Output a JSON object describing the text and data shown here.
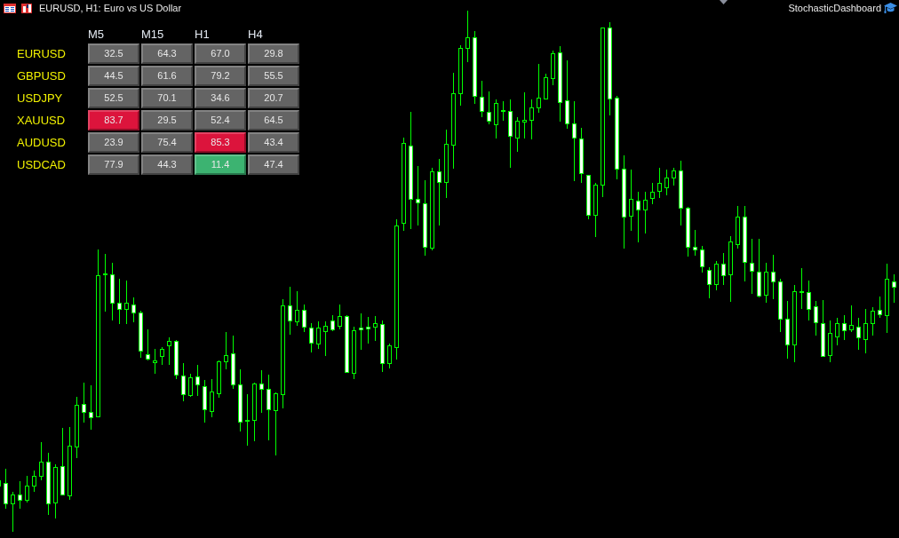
{
  "window": {
    "title": "EURUSD, H1: Euro vs US Dollar"
  },
  "indicator_label": "StochasticDashboard",
  "dashboard": {
    "columns": [
      "M5",
      "M15",
      "H1",
      "H4"
    ],
    "rows": [
      {
        "symbol": "EURUSD",
        "cells": [
          {
            "value": "32.5",
            "color": "#646464"
          },
          {
            "value": "64.3",
            "color": "#646464"
          },
          {
            "value": "67.0",
            "color": "#646464"
          },
          {
            "value": "29.8",
            "color": "#646464"
          }
        ]
      },
      {
        "symbol": "GBPUSD",
        "cells": [
          {
            "value": "44.5",
            "color": "#646464"
          },
          {
            "value": "61.6",
            "color": "#646464"
          },
          {
            "value": "79.2",
            "color": "#646464"
          },
          {
            "value": "55.5",
            "color": "#646464"
          }
        ]
      },
      {
        "symbol": "USDJPY",
        "cells": [
          {
            "value": "52.5",
            "color": "#646464"
          },
          {
            "value": "70.1",
            "color": "#646464"
          },
          {
            "value": "34.6",
            "color": "#646464"
          },
          {
            "value": "20.7",
            "color": "#646464"
          }
        ]
      },
      {
        "symbol": "XAUUSD",
        "cells": [
          {
            "value": "83.7",
            "color": "#dc143c"
          },
          {
            "value": "29.5",
            "color": "#646464"
          },
          {
            "value": "52.4",
            "color": "#646464"
          },
          {
            "value": "64.5",
            "color": "#646464"
          }
        ]
      },
      {
        "symbol": "AUDUSD",
        "cells": [
          {
            "value": "23.9",
            "color": "#646464"
          },
          {
            "value": "75.4",
            "color": "#646464"
          },
          {
            "value": "85.3",
            "color": "#dc143c"
          },
          {
            "value": "43.4",
            "color": "#646464"
          }
        ]
      },
      {
        "symbol": "USDCAD",
        "cells": [
          {
            "value": "77.9",
            "color": "#646464"
          },
          {
            "value": "44.3",
            "color": "#646464"
          },
          {
            "value": "11.4",
            "color": "#3cb371"
          },
          {
            "value": "47.4",
            "color": "#646464"
          }
        ]
      }
    ]
  }
}
